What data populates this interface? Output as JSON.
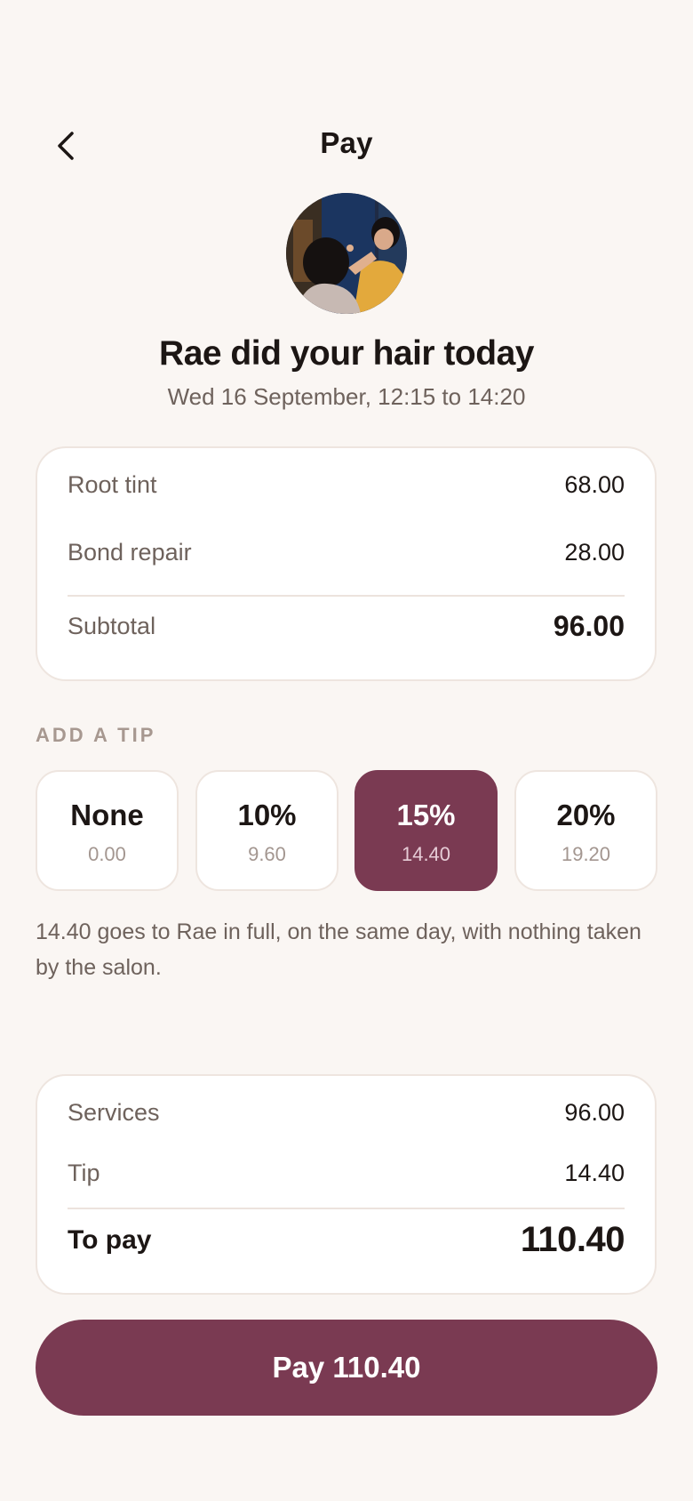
{
  "header": {
    "title": "Pay",
    "back_icon": "chevron-left-icon"
  },
  "stylist": {
    "headline": "Rae did your hair today",
    "appointment": "Wed 16 September, 12:15 to 14:20",
    "avatar": "stylist-photo"
  },
  "services": {
    "items": [
      {
        "label": "Root tint",
        "value": "68.00"
      },
      {
        "label": "Bond repair",
        "value": "28.00"
      }
    ],
    "subtotal_label": "Subtotal",
    "subtotal_value": "96.00"
  },
  "tip": {
    "heading": "ADD A TIP",
    "options": [
      {
        "label": "None",
        "amount": "0.00",
        "selected": false
      },
      {
        "label": "10%",
        "amount": "9.60",
        "selected": false
      },
      {
        "label": "15%",
        "amount": "14.40",
        "selected": true
      },
      {
        "label": "20%",
        "amount": "19.20",
        "selected": false
      }
    ],
    "note": "14.40 goes to Rae in full, on the same day, with nothing taken by the salon."
  },
  "summary": {
    "services_label": "Services",
    "services_value": "96.00",
    "tip_label": "Tip",
    "tip_value": "14.40",
    "total_label": "To pay",
    "total_value": "110.40"
  },
  "pay_button": {
    "label": "Pay 110.40"
  },
  "colors": {
    "accent": "#7a3a52",
    "background": "#faf6f3",
    "muted_text": "#6e625c"
  }
}
